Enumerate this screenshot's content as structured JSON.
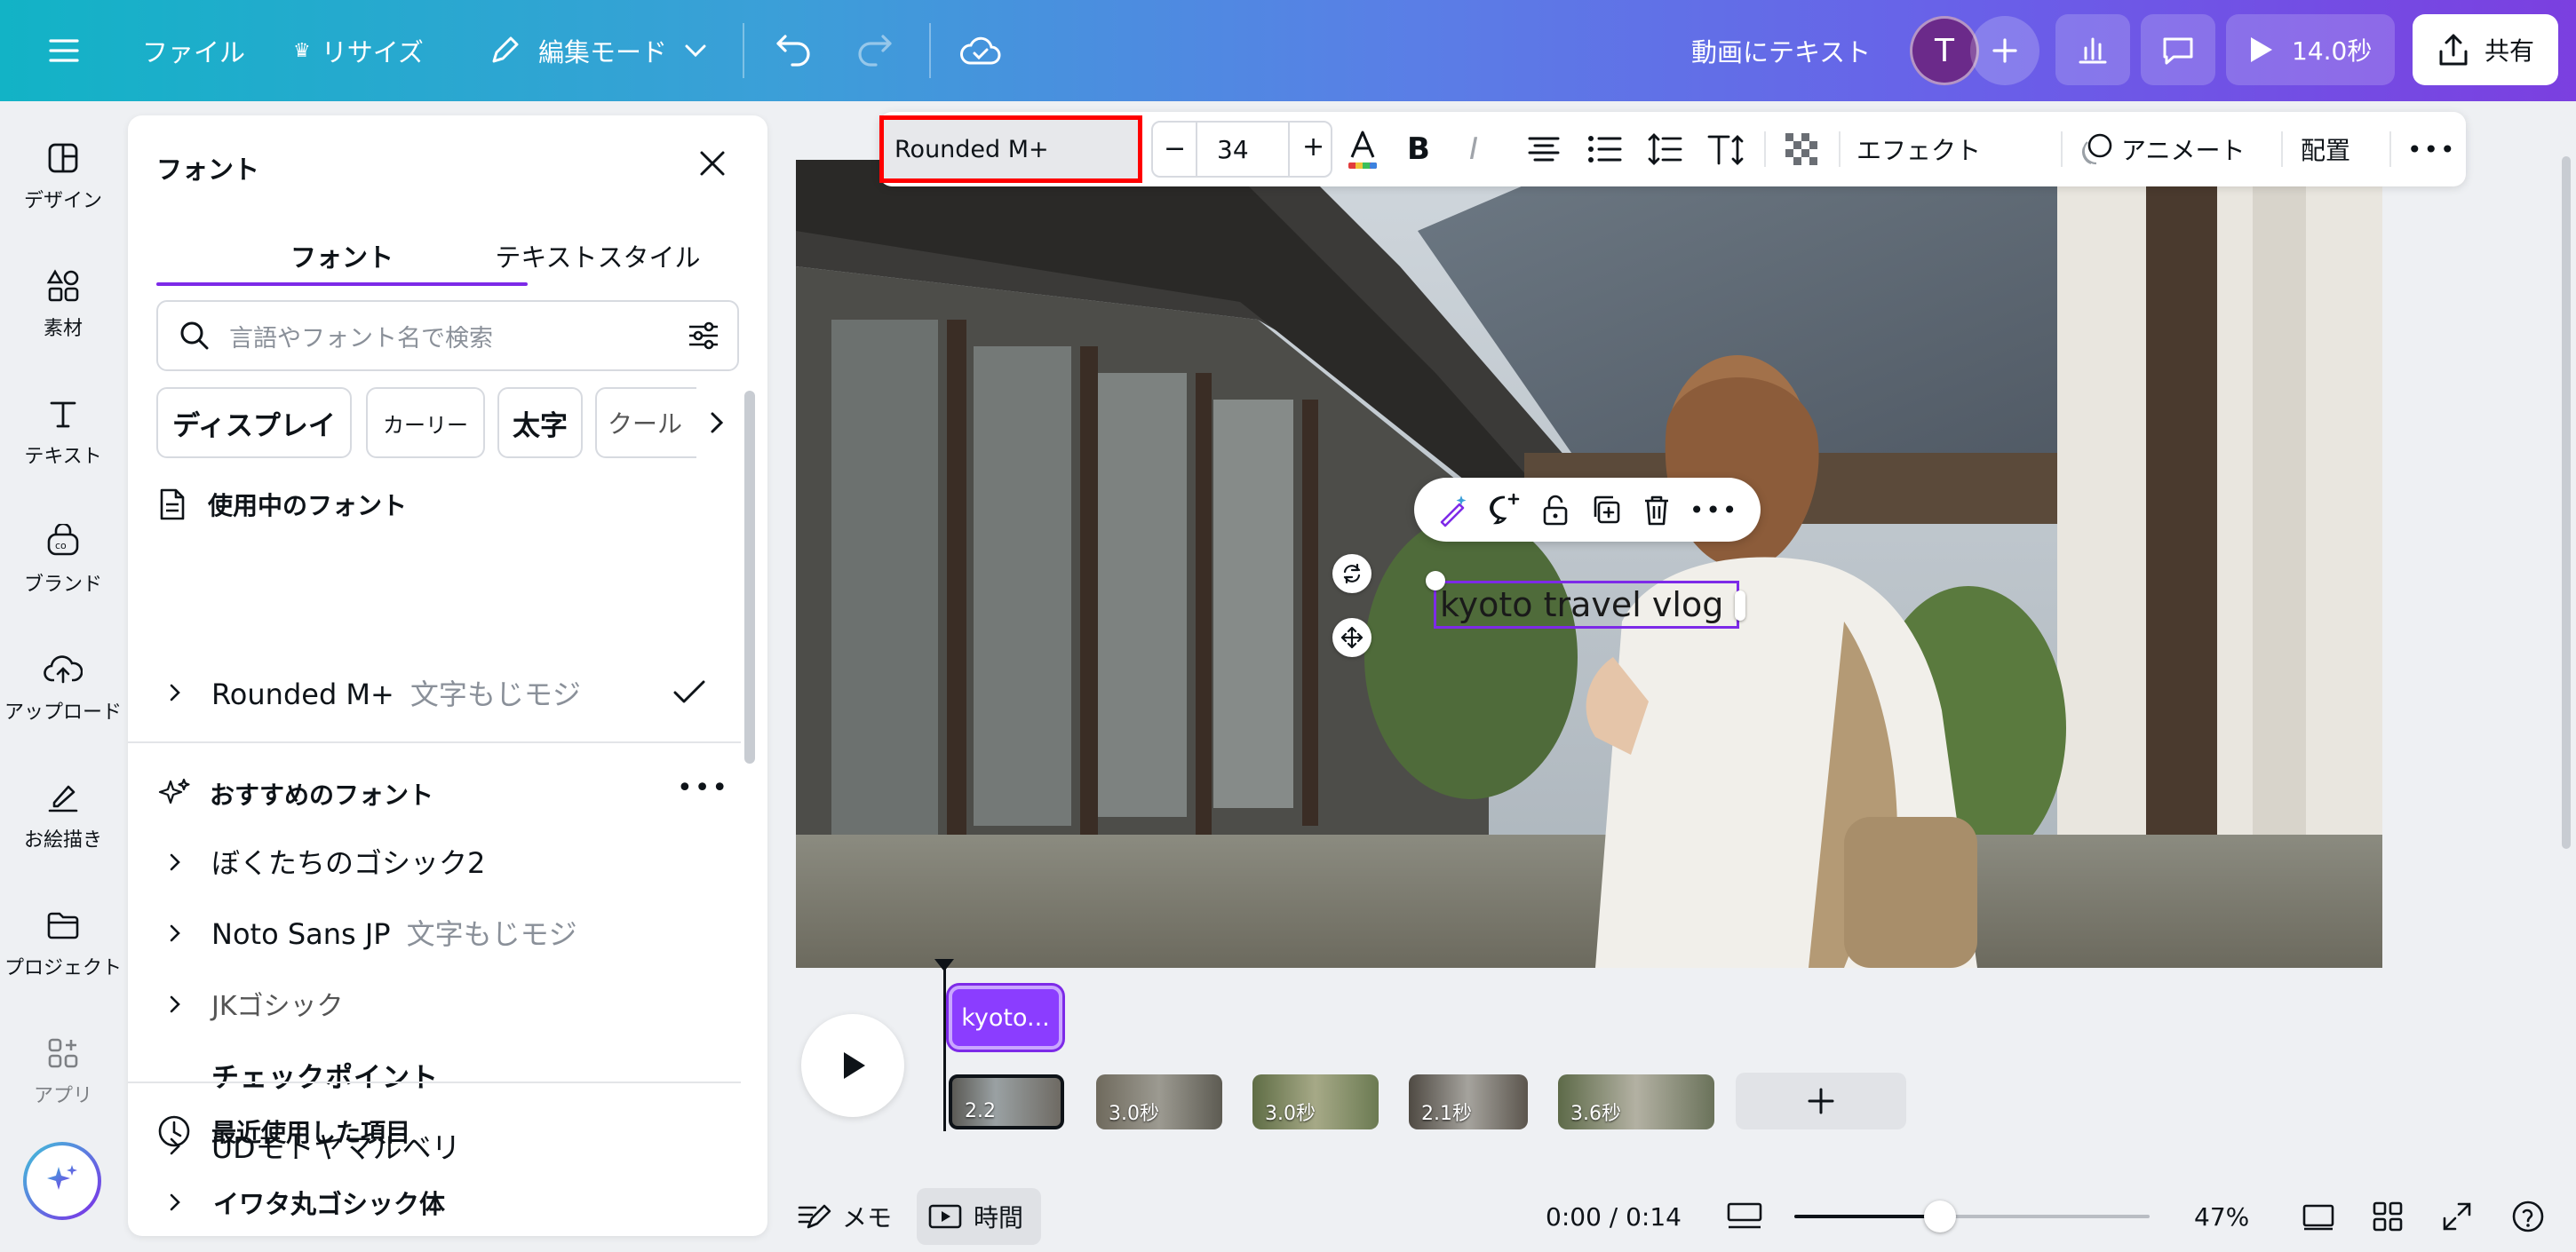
{
  "topbar": {
    "file": "ファイル",
    "resize": "リサイズ",
    "edit_mode": "編集モード",
    "doc_title": "動画にテキスト",
    "avatar_initial": "T",
    "duration": "14.0秒",
    "share": "共有"
  },
  "rail": {
    "items": [
      "デザイン",
      "素材",
      "テキスト",
      "ブランド",
      "アップロード",
      "お絵描き",
      "プロジェクト",
      "アプリ"
    ]
  },
  "panel": {
    "title": "フォント",
    "tabs": [
      "フォント",
      "テキストスタイル"
    ],
    "search_placeholder": "言語やフォント名で検索",
    "chips": [
      "ディスプレイ",
      "カーリー",
      "太字",
      "クール"
    ],
    "in_use_heading": "使用中のフォント",
    "in_use": [
      {
        "name": "Rounded M+",
        "sample": "文字もじモジ"
      }
    ],
    "recommended_heading": "おすすめのフォント",
    "recommended": [
      {
        "name": "ぼくたちのゴシック2",
        "sample": ""
      },
      {
        "name": "Noto Sans JP",
        "sample": "文字もじモジ"
      },
      {
        "name": "JKゴシック",
        "sample": ""
      },
      {
        "name": "チェックポイント",
        "sample": ""
      },
      {
        "name": "UDモトヤマルベリ",
        "sample": ""
      }
    ],
    "recent_heading": "最近使用した項目",
    "recent": [
      {
        "name": "イワタ丸ゴシック体"
      }
    ]
  },
  "text_toolbar": {
    "font_name": "Rounded M+",
    "font_size": "34",
    "effects": "エフェクト",
    "animate": "アニメート",
    "position": "配置"
  },
  "canvas": {
    "text": "kyoto travel vlog"
  },
  "timeline": {
    "text_clip": "kyoto...",
    "clips": [
      "2.2",
      "3.0秒",
      "3.0秒",
      "2.1秒",
      "3.6秒"
    ]
  },
  "bottombar": {
    "notes": "メモ",
    "time": "時間",
    "timecode": "0:00 / 0:14",
    "zoom": "47%",
    "zoom_fraction": 0.41
  },
  "colors": {
    "accent_purple": "#7d2ae8",
    "highlight_red": "#ff0000"
  }
}
